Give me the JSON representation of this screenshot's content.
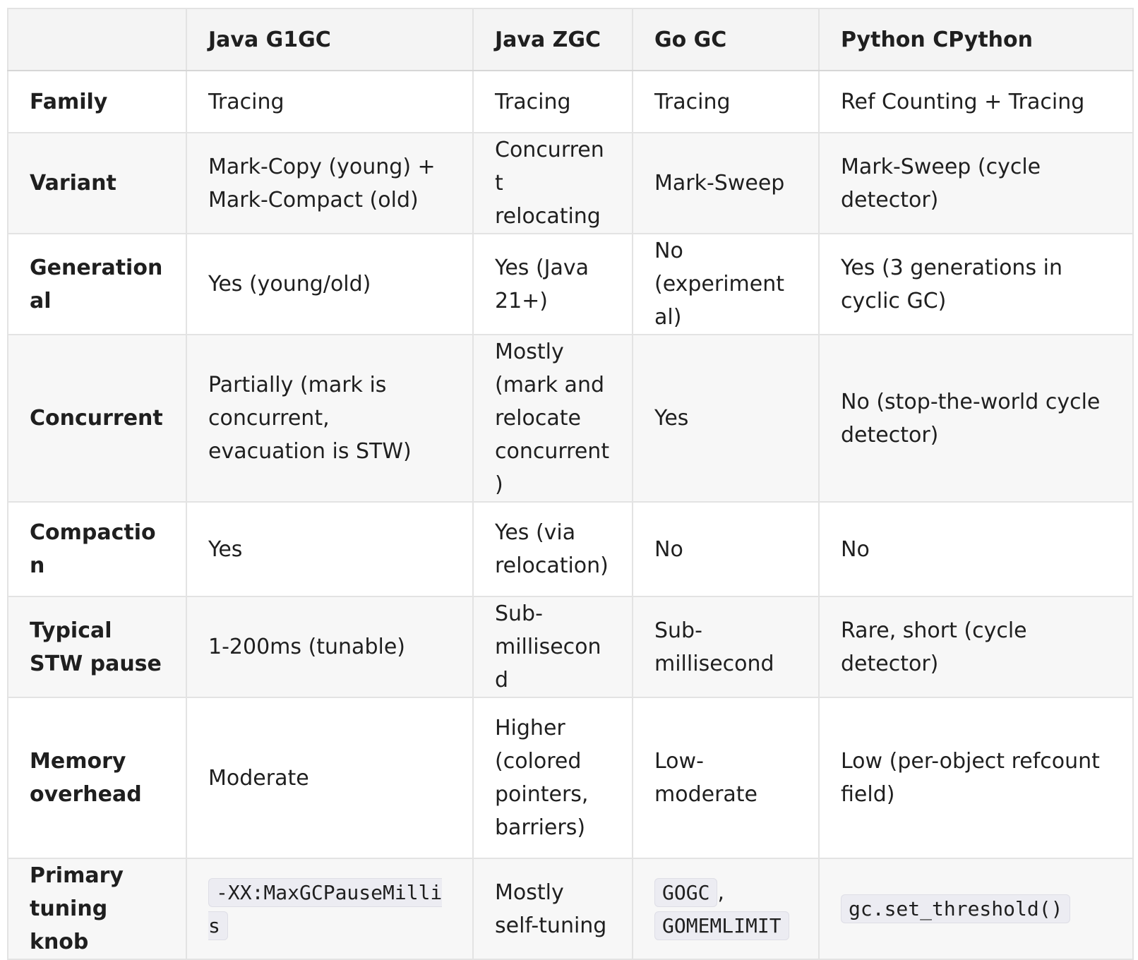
{
  "table": {
    "headers": [
      "",
      "Java G1GC",
      "Java ZGC",
      "Go GC",
      "Python CPython"
    ],
    "rows": {
      "family": [
        "Family",
        "Tracing",
        "Tracing",
        "Tracing",
        "Ref Counting + Tracing"
      ],
      "variant": [
        "Variant",
        "Mark-Copy (young) + Mark-Compact (old)",
        "Concurrent relocating",
        "Mark-Sweep",
        "Mark-Sweep (cycle detector)"
      ],
      "generational": [
        "Generational",
        "Yes (young/old)",
        "Yes (Java 21+)",
        "No (experimental)",
        "Yes (3 generations in cyclic GC)"
      ],
      "concurrent": [
        "Concurrent",
        "Partially (mark is concurrent, evacuation is STW)",
        "Mostly (mark and relocate concurrent)",
        "Yes",
        "No (stop-the-world cycle detector)"
      ],
      "compaction": [
        "Compaction",
        "Yes",
        "Yes (via relocation)",
        "No",
        "No"
      ],
      "pause": [
        "Typical STW pause",
        "1-200ms (tunable)",
        "Sub-millisecond",
        "Sub-millisecond",
        "Rare, short (cycle detector)"
      ],
      "memory": [
        "Memory overhead",
        "Moderate",
        "Higher (colored pointers, barriers)",
        "Low-moderate",
        "Low (per-object refcount field)"
      ],
      "tuning": {
        "label": "Primary tuning knob",
        "g1gc_code": "-XX:MaxGCPauseMillis",
        "zgc": "Mostly self-tuning",
        "go_code_1": "GOGC",
        "go_sep": ",",
        "go_code_2": "GOMEMLIMIT",
        "python_code": "gc.set_threshold()"
      }
    }
  }
}
